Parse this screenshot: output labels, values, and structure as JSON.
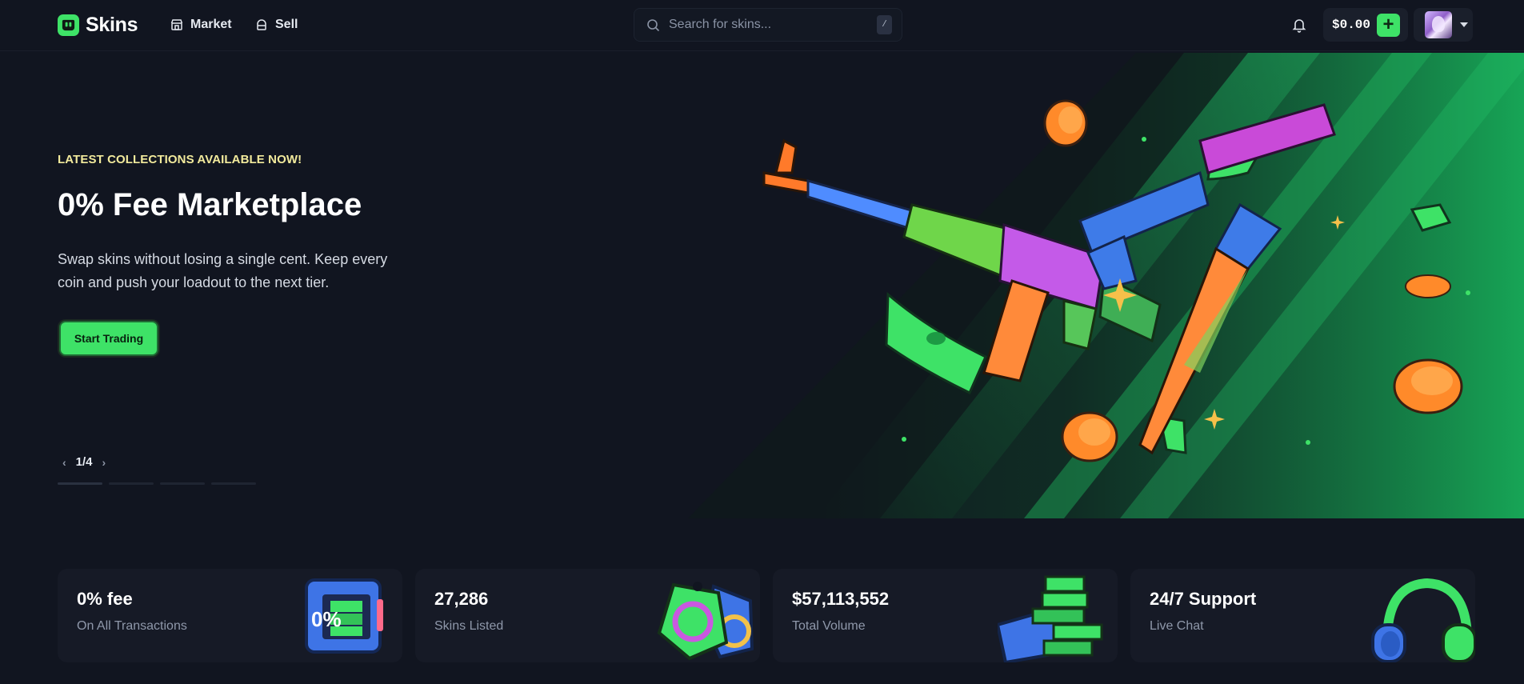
{
  "brand": {
    "name": "Skins",
    "accent": "#3ee267"
  },
  "nav": [
    {
      "label": "Market",
      "icon": "storefront-icon"
    },
    {
      "label": "Sell",
      "icon": "tag-icon"
    }
  ],
  "search": {
    "placeholder": "Search for skins...",
    "shortcut": "/"
  },
  "account": {
    "balance": "$0.00",
    "add_icon": "plus-icon",
    "notifications_icon": "bell-icon"
  },
  "hero": {
    "kicker": "LATEST COLLECTIONS AVAILABLE NOW!",
    "title": "0% Fee Marketplace",
    "subtitle": "Swap skins without losing a single cent. Keep every coin and push your loadout to the next tier.",
    "cta": "Start Trading",
    "slide_indicator": "1/4",
    "slide_count": 4,
    "current_slide": 1
  },
  "stats": [
    {
      "title": "0% fee",
      "subtitle": "On All Transactions",
      "icon": "safe-icon"
    },
    {
      "title": "27,286",
      "subtitle": "Skins Listed",
      "icon": "tags-icon"
    },
    {
      "title": "$57,113,552",
      "subtitle": "Total Volume",
      "icon": "cash-stack-icon"
    },
    {
      "title": "24/7 Support",
      "subtitle": "Live Chat",
      "icon": "headset-icon"
    }
  ]
}
